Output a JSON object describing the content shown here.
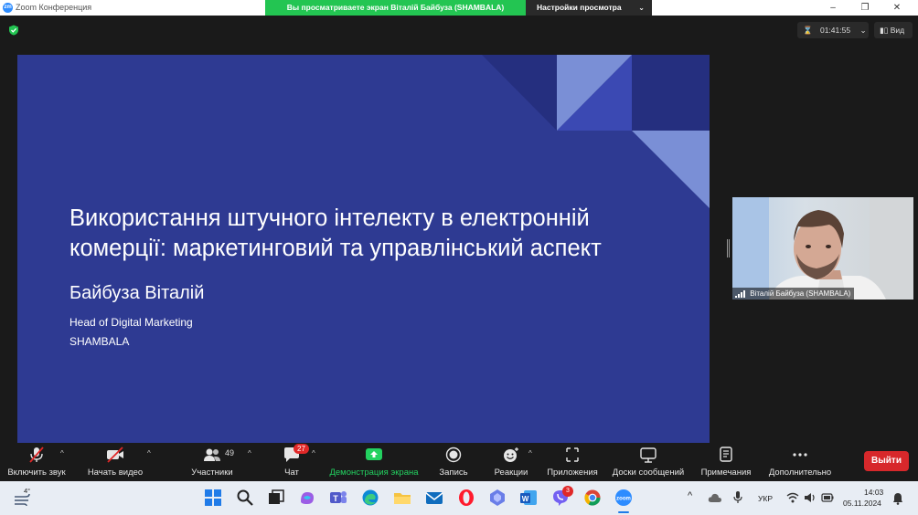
{
  "window": {
    "logo": "zm",
    "title": "Zoom Конференция",
    "share_banner": "Вы просматриваете экран Віталій Байбуза (SHAMBALA)",
    "view_options": "Настройки просмотра",
    "controls": {
      "minimize": "–",
      "maximize": "❐",
      "close": "✕"
    }
  },
  "meeting": {
    "timer": "01:41:55",
    "view_label": "Вид"
  },
  "slide": {
    "title_line1": "Використання штучного інтелекту в електронній",
    "title_line2": "комерції: маркетинговий та управлінський аспект",
    "author": "Байбуза Віталій",
    "role": "Head of Digital Marketing",
    "company": "SHAMBALA",
    "colors": {
      "background": "#2e3a92",
      "light_triangle": "#7a8fd6",
      "dark_triangle": "#252f7f",
      "mid_triangle": "#3b49b3"
    }
  },
  "participant_video": {
    "name": "Віталій Байбуза (SHAMBALA)"
  },
  "toolbar": {
    "unmute": "Включить звук",
    "start_video": "Начать видео",
    "participants": "Участники",
    "participants_count": "49",
    "chat": "Чат",
    "chat_badge": "27",
    "share_screen": "Демонстрация экрана",
    "record": "Запись",
    "reactions": "Реакции",
    "apps": "Приложения",
    "whiteboards": "Доски сообщений",
    "notes": "Примечания",
    "more": "Дополнительно",
    "leave": "Выйти",
    "colors": {
      "share_green": "#23d160",
      "leave_red": "#d7282b"
    }
  },
  "taskbar": {
    "weather_temp": "4°",
    "viber_badge": "3",
    "language": "УКР",
    "time": "14:03",
    "date": "05.11.2024",
    "apps": [
      "start-icon",
      "search-icon",
      "task-view-icon",
      "copilot-icon",
      "teams-icon",
      "edge-icon",
      "explorer-icon",
      "mail-icon",
      "opera-icon",
      "app-icon",
      "word-icon",
      "viber-icon",
      "chrome-icon",
      "zoom-icon"
    ]
  }
}
